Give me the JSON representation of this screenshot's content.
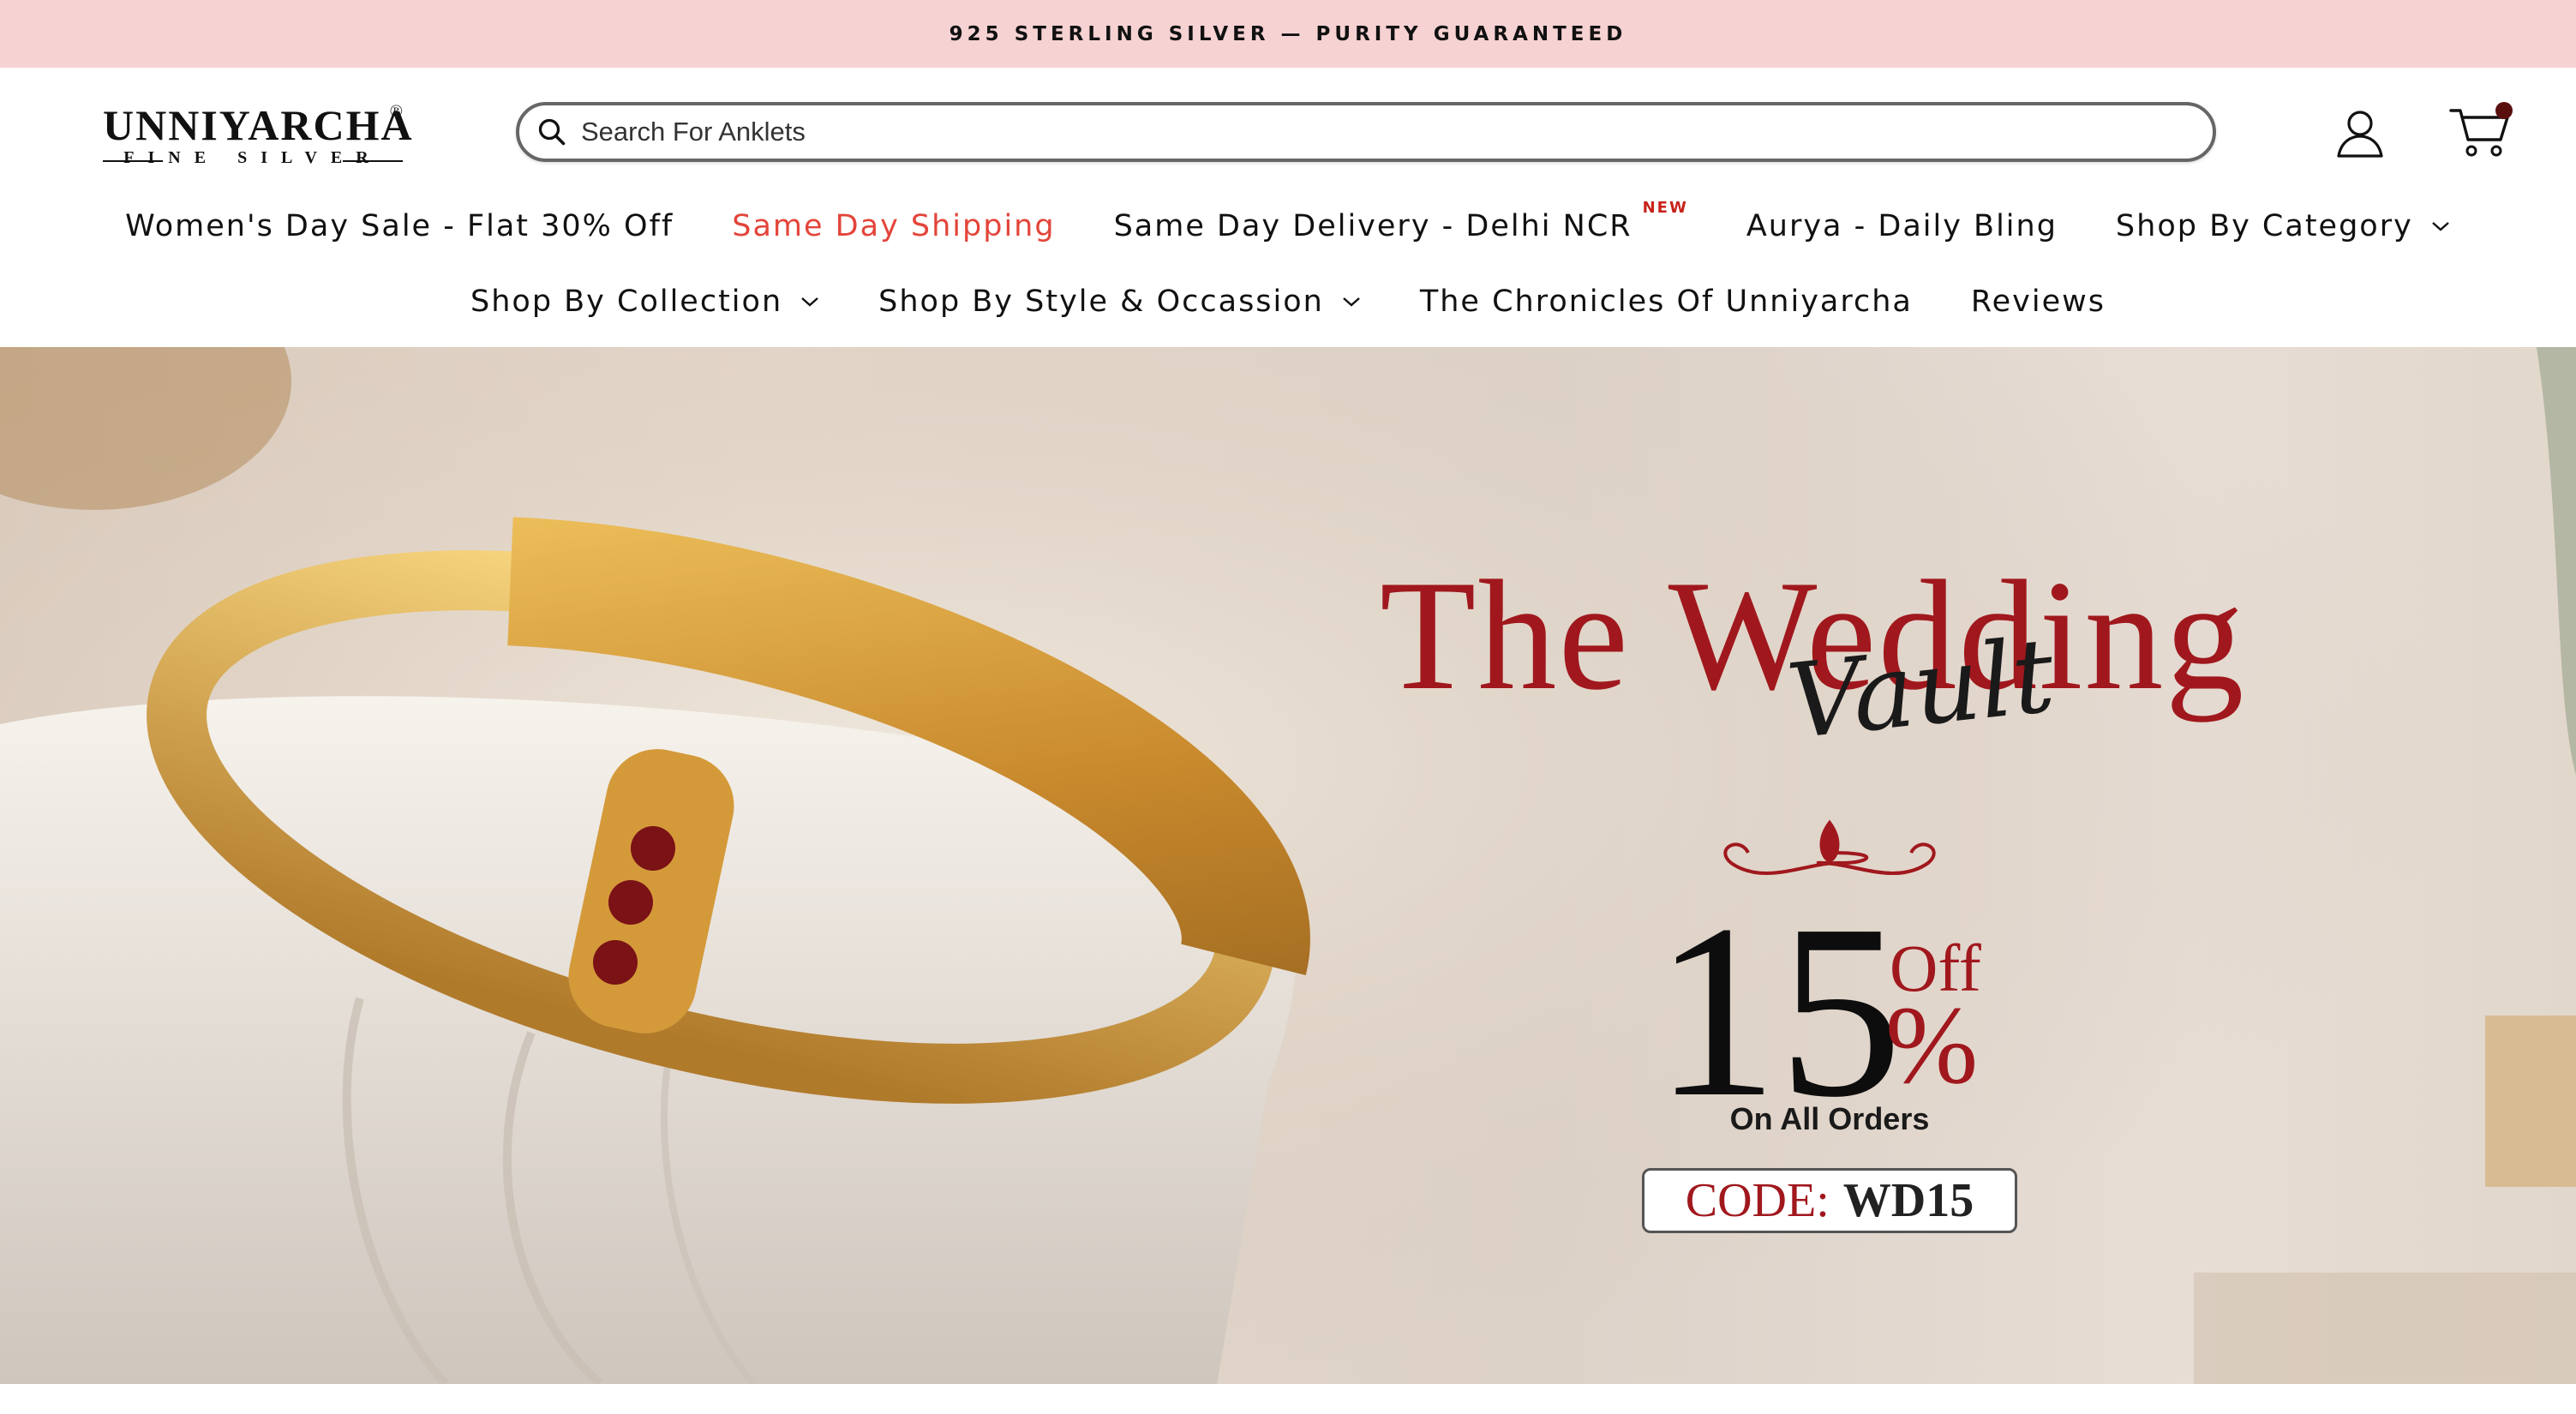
{
  "announcement": {
    "text": "925 STERLING SILVER — PURITY GUARANTEED"
  },
  "header": {
    "logo": {
      "main": "UNNIYARCHA",
      "registered": "®",
      "sub": "FINE SILVER"
    },
    "search": {
      "placeholder": "Search For Anklets",
      "value": ""
    },
    "icons": {
      "search": "search-icon",
      "account": "user-icon",
      "cart": "cart-icon"
    }
  },
  "nav": {
    "row1": [
      {
        "label": "Women's Day Sale - Flat 30% Off"
      },
      {
        "label": "Same Day Shipping",
        "accent": true
      },
      {
        "label": "Same Day Delivery - Delhi NCR",
        "badge": "NEW"
      },
      {
        "label": "Aurya - Daily Bling"
      },
      {
        "label": "Shop By Category",
        "dropdown": true
      }
    ],
    "row2": [
      {
        "label": "Shop By Collection",
        "dropdown": true
      },
      {
        "label": "Shop By Style & Occassion",
        "dropdown": true
      },
      {
        "label": "The Chronicles Of Unniyarcha"
      },
      {
        "label": "Reviews"
      }
    ]
  },
  "hero": {
    "title": "The Wedding",
    "script": "Vault",
    "discount_number": "15",
    "discount_off": "Off",
    "discount_percent": "%",
    "subtitle": "On All Orders",
    "code_label": "CODE:",
    "code_value": "WD15"
  },
  "colors": {
    "announcement_bg": "#f6d2d3",
    "accent_red": "#e3453a",
    "hero_red": "#a0181d",
    "gold": "#d9a441"
  }
}
